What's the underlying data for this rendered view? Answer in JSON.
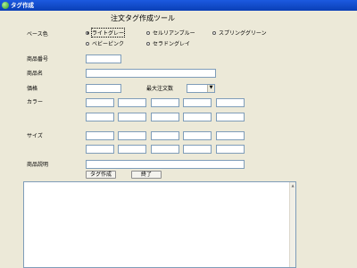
{
  "window": {
    "title": "タグ作成"
  },
  "form": {
    "heading": "注文タグ作成ツール",
    "base_color_label": "ベース色",
    "base_color_options": [
      {
        "label": "ライトグレー",
        "selected": true
      },
      {
        "label": "セルリアンブルー",
        "selected": false
      },
      {
        "label": "スプリンググリーン",
        "selected": false
      },
      {
        "label": "ベビーピンク",
        "selected": false
      },
      {
        "label": "セラドングレイ",
        "selected": false
      }
    ],
    "product_number_label": "商品番号",
    "product_number_value": "",
    "product_name_label": "商品名",
    "product_name_value": "",
    "price_label": "価格",
    "price_value": "",
    "max_order_label": "最大注文数",
    "max_order_value": "",
    "color_label": "カラー",
    "size_label": "サイズ",
    "description_label": "商品説明",
    "description_value": "",
    "buttons": {
      "create": "タグ作成",
      "exit": "終了"
    },
    "output_text": ""
  },
  "icons": {
    "titlebar": "app-leaf-icon",
    "dropdown": "chevron-down-icon",
    "scroll_up": "scroll-up-arrow-icon"
  }
}
